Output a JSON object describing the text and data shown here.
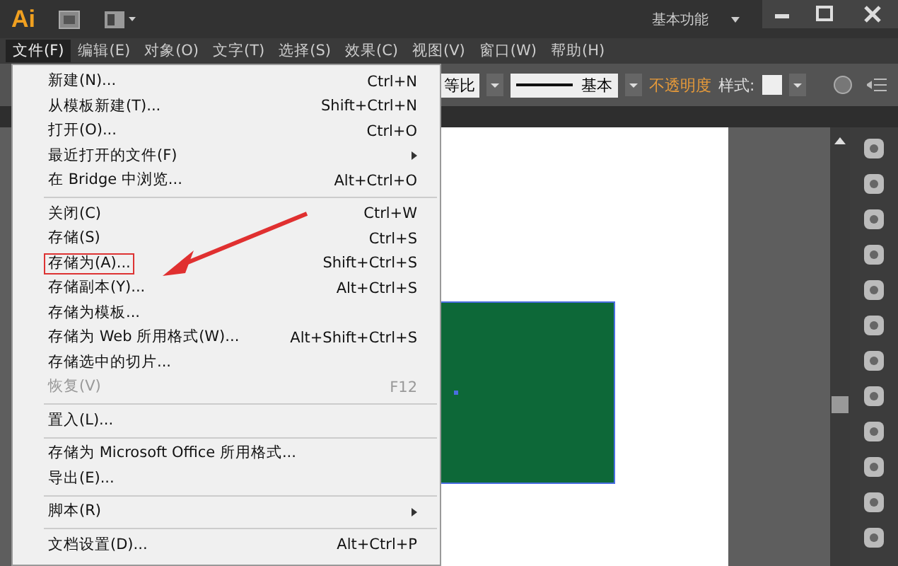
{
  "title_bar": {
    "logo": "Ai",
    "workspace": "基本功能"
  },
  "menu_bar": [
    {
      "label": "文件(F)",
      "selected": true
    },
    {
      "label": "编辑(E)",
      "selected": false
    },
    {
      "label": "对象(O)",
      "selected": false
    },
    {
      "label": "文字(T)",
      "selected": false
    },
    {
      "label": "选择(S)",
      "selected": false
    },
    {
      "label": "效果(C)",
      "selected": false
    },
    {
      "label": "视图(V)",
      "selected": false
    },
    {
      "label": "窗口(W)",
      "selected": false
    },
    {
      "label": "帮助(H)",
      "selected": false
    }
  ],
  "control_bar": {
    "scale": "等比",
    "stroke": "基本",
    "opacity": "不透明度",
    "style": "样式:"
  },
  "file_menu": [
    {
      "kind": "item",
      "label": "新建(N)...",
      "shortcut": "Ctrl+N",
      "disabled": false,
      "submenu": false,
      "highlighted": false
    },
    {
      "kind": "item",
      "label": "从模板新建(T)...",
      "shortcut": "Shift+Ctrl+N",
      "disabled": false,
      "submenu": false,
      "highlighted": false
    },
    {
      "kind": "item",
      "label": "打开(O)...",
      "shortcut": "Ctrl+O",
      "disabled": false,
      "submenu": false,
      "highlighted": false
    },
    {
      "kind": "item",
      "label": "最近打开的文件(F)",
      "disabled": false,
      "submenu": true,
      "highlighted": false
    },
    {
      "kind": "item",
      "label": "在 Bridge 中浏览...",
      "shortcut": "Alt+Ctrl+O",
      "disabled": false,
      "submenu": false,
      "highlighted": false
    },
    {
      "kind": "separator"
    },
    {
      "kind": "item",
      "label": "关闭(C)",
      "shortcut": "Ctrl+W",
      "disabled": false,
      "submenu": false,
      "highlighted": false
    },
    {
      "kind": "item",
      "label": "存储(S)",
      "shortcut": "Ctrl+S",
      "disabled": false,
      "submenu": false,
      "highlighted": false
    },
    {
      "kind": "item",
      "label": "存储为(A)...",
      "shortcut": "Shift+Ctrl+S",
      "disabled": false,
      "submenu": false,
      "highlighted": true
    },
    {
      "kind": "item",
      "label": "存储副本(Y)...",
      "shortcut": "Alt+Ctrl+S",
      "disabled": false,
      "submenu": false,
      "highlighted": false
    },
    {
      "kind": "item",
      "label": "存储为模板...",
      "disabled": false,
      "submenu": false,
      "highlighted": false
    },
    {
      "kind": "item",
      "label": "存储为 Web 所用格式(W)...",
      "shortcut": "Alt+Shift+Ctrl+S",
      "disabled": false,
      "submenu": false,
      "highlighted": false
    },
    {
      "kind": "item",
      "label": "存储选中的切片...",
      "disabled": false,
      "submenu": false,
      "highlighted": false
    },
    {
      "kind": "item",
      "label": "恢复(V)",
      "shortcut": "F12",
      "disabled": true,
      "submenu": false,
      "highlighted": false
    },
    {
      "kind": "separator"
    },
    {
      "kind": "item",
      "label": "置入(L)...",
      "disabled": false,
      "submenu": false,
      "highlighted": false
    },
    {
      "kind": "separator"
    },
    {
      "kind": "item",
      "label": "存储为 Microsoft Office 所用格式...",
      "disabled": false,
      "submenu": false,
      "highlighted": false
    },
    {
      "kind": "item",
      "label": "导出(E)...",
      "disabled": false,
      "submenu": false,
      "highlighted": false
    },
    {
      "kind": "separator"
    },
    {
      "kind": "item",
      "label": "脚本(R)",
      "disabled": false,
      "submenu": true,
      "highlighted": false
    },
    {
      "kind": "separator"
    },
    {
      "kind": "item",
      "label": "文档设置(D)...",
      "shortcut": "Alt+Ctrl+P",
      "disabled": false,
      "submenu": false,
      "highlighted": false
    }
  ]
}
